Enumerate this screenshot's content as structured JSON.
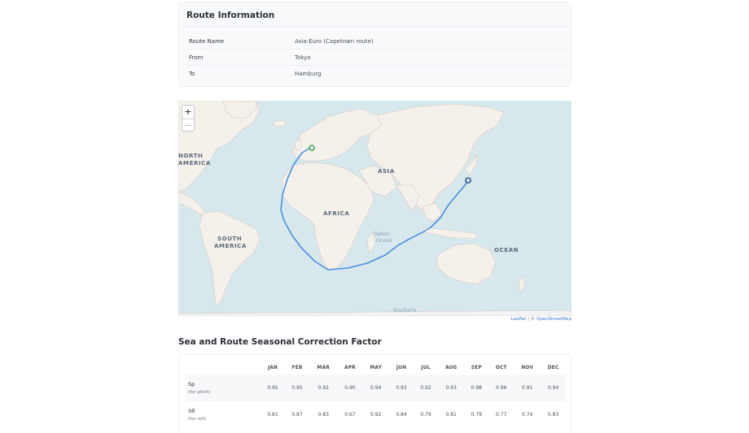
{
  "route_info": {
    "title": "Route Information",
    "rows": [
      {
        "label": "Route Name",
        "value": "Asia-Euro (Capetown route)"
      },
      {
        "label": "From",
        "value": "Tokyo"
      },
      {
        "label": "To",
        "value": "Hamburg"
      }
    ]
  },
  "map": {
    "zoom_in": "+",
    "zoom_out": "−",
    "labels": {
      "north_america_1": "NORTH",
      "north_america_2": "AMERICA",
      "south_america_1": "SOUTH",
      "south_america_2": "AMERICA",
      "asia": "ASIA",
      "africa": "AFRICA",
      "indian_ocean_1": "Indian",
      "indian_ocean_2": "Ocean",
      "ocean": "OCEAN",
      "southern": "Southern"
    },
    "attribution_leaflet": "Leaflet",
    "attribution_sep": " | © ",
    "attribution_osm": "OpenStreetMap",
    "colors": {
      "route": "#4a90e2",
      "origin_marker": "#1f4e9c",
      "destination_marker": "#3aa845",
      "sea": "#d6e8ec",
      "land": "#f4f1ea"
    }
  },
  "seasonal": {
    "title": "Sea and Route Seasonal Correction Factor",
    "months": [
      "JAN",
      "FEB",
      "MAR",
      "APR",
      "MAY",
      "JUN",
      "JUL",
      "AUG",
      "SEP",
      "OCT",
      "NOV",
      "DEC"
    ],
    "rows": [
      {
        "name": "Sp",
        "sub": "(for pitch)",
        "values": [
          "0.95",
          "0.95",
          "0.92",
          "0.90",
          "0.94",
          "0.93",
          "0.92",
          "0.93",
          "0.98",
          "0.96",
          "0.91",
          "0.94"
        ]
      },
      {
        "name": "Sθ",
        "sub": "(for roll)",
        "values": [
          "0.81",
          "0.87",
          "0.83",
          "0.67",
          "0.92",
          "0.84",
          "0.79",
          "0.81",
          "0.79",
          "0.77",
          "0.74",
          "0.83"
        ]
      }
    ]
  }
}
